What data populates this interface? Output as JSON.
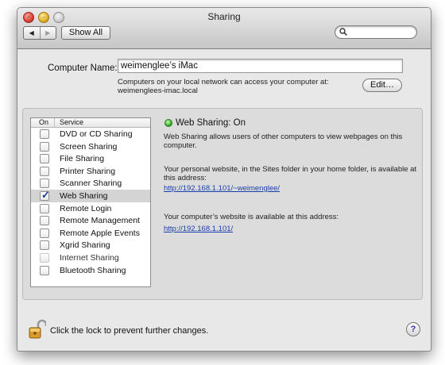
{
  "window": {
    "title": "Sharing"
  },
  "toolbar": {
    "show_all_label": "Show All",
    "search_placeholder": ""
  },
  "computer_name": {
    "label": "Computer Name:",
    "value": "weimenglee’s iMac",
    "description_line1": "Computers on your local network can access your computer at:",
    "description_line2": "weimenglees-imac.local",
    "edit_label": "Edit…"
  },
  "services": {
    "header_on": "On",
    "header_service": "Service",
    "items": [
      {
        "label": "DVD or CD Sharing",
        "checked": false
      },
      {
        "label": "Screen Sharing",
        "checked": false
      },
      {
        "label": "File Sharing",
        "checked": false
      },
      {
        "label": "Printer Sharing",
        "checked": false
      },
      {
        "label": "Scanner Sharing",
        "checked": false
      },
      {
        "label": "Web Sharing",
        "checked": true,
        "selected": true
      },
      {
        "label": "Remote Login",
        "checked": false
      },
      {
        "label": "Remote Management",
        "checked": false
      },
      {
        "label": "Remote Apple Events",
        "checked": false
      },
      {
        "label": "Xgrid Sharing",
        "checked": false
      },
      {
        "label": "Internet Sharing",
        "checked": false,
        "disabled": true
      },
      {
        "label": "Bluetooth Sharing",
        "checked": false
      }
    ]
  },
  "detail": {
    "status": "Web Sharing: On",
    "status_color": "#36b22a",
    "description": "Web Sharing allows users of other computers to view webpages on this computer.",
    "personal_text": "Your personal website, in the Sites folder in your home folder, is available at this address:",
    "personal_link": "http://192.168.1.101/~weimenglee/",
    "computer_text": "Your computer’s website is available at this address:",
    "computer_link": "http://192.168.1.101/"
  },
  "footer": {
    "lock_text": "Click the lock to prevent further changes.",
    "help_label": "?"
  }
}
